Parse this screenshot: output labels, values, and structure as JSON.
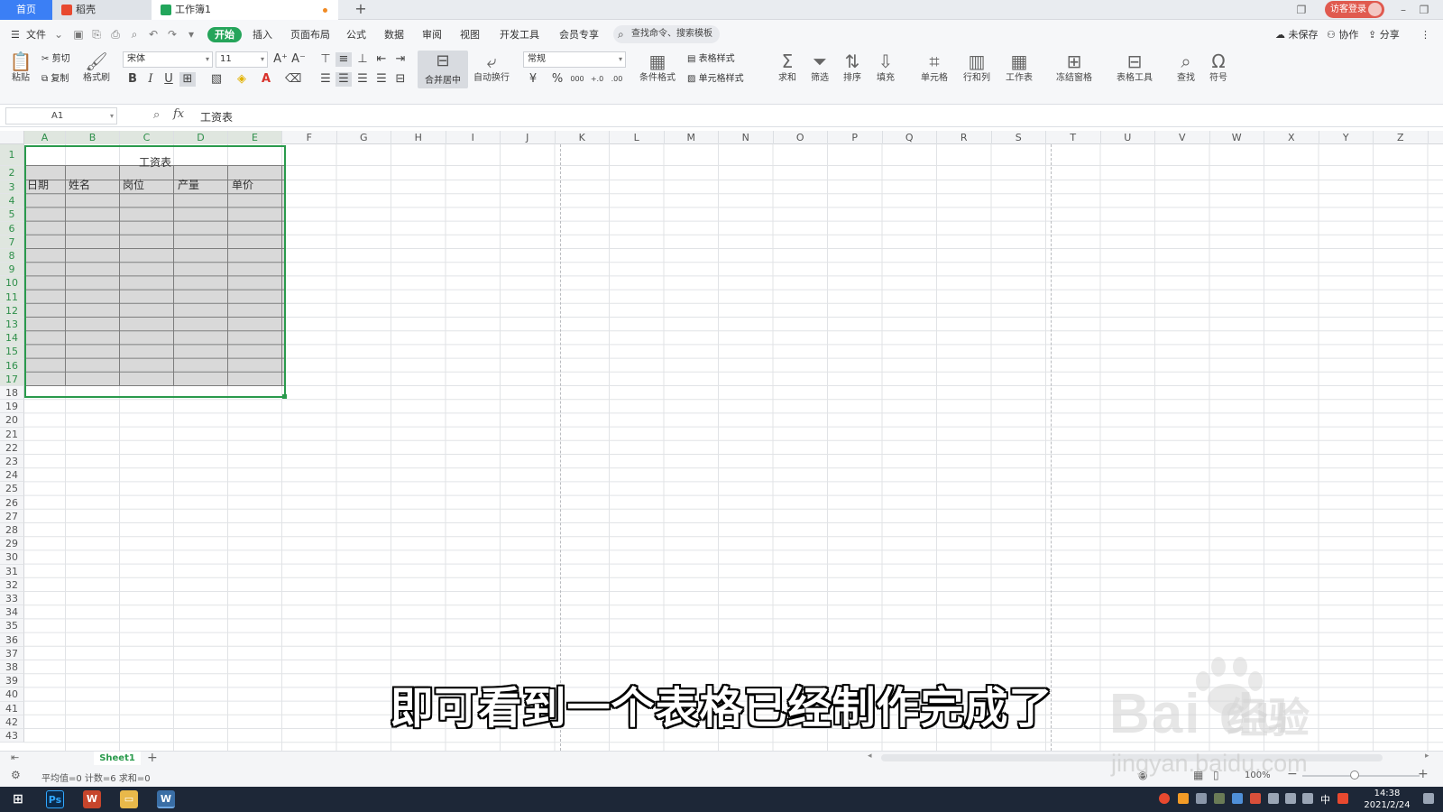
{
  "tabs": {
    "home": "首页",
    "wps": "稻壳",
    "workbook": "工作簿1",
    "add": "+"
  },
  "titlebar": {
    "visitor_login": "访客登录"
  },
  "menu": {
    "file": "文件",
    "items": [
      "开始",
      "插入",
      "页面布局",
      "公式",
      "数据",
      "审阅",
      "视图",
      "开发工具",
      "会员专享"
    ],
    "search_placeholder": "查找命令、搜索模板",
    "unsaved": "未保存",
    "collab": "协作",
    "share": "分享"
  },
  "ribbon": {
    "paste": "粘贴",
    "cut": "剪切",
    "copy": "复制",
    "format_painter": "格式刷",
    "font": "宋体",
    "size": "11",
    "bold": "B",
    "italic": "I",
    "underline": "U",
    "merge_center": "合并居中",
    "wrap": "自动换行",
    "number_format": "常规",
    "currency": "¥",
    "percent": "%",
    "thousands": "000",
    "inc_decimal": "+.0",
    "dec_decimal": ".00",
    "cond_format": "条件格式",
    "table_style": "表格样式",
    "cell_style": "单元格样式",
    "sum": "求和",
    "filter": "筛选",
    "sort": "排序",
    "fill": "填充",
    "cell": "单元格",
    "rowcol": "行和列",
    "worksheet": "工作表",
    "freeze": "冻结窗格",
    "table_tools": "表格工具",
    "find": "查找",
    "symbol": "符号"
  },
  "formula_bar": {
    "name_box": "A1",
    "fx": "fx",
    "content": "工资表"
  },
  "sheet": {
    "columns": [
      "A",
      "B",
      "C",
      "D",
      "E",
      "F",
      "G",
      "H",
      "I",
      "J",
      "K",
      "L",
      "M",
      "N",
      "O",
      "P",
      "Q",
      "R",
      "S",
      "T",
      "U",
      "V",
      "W",
      "X",
      "Y",
      "Z"
    ],
    "row_count": 43,
    "title": "工资表",
    "headers": [
      "日期",
      "姓名",
      "岗位",
      "产量",
      "单价"
    ]
  },
  "sheet_tabs": {
    "active": "Sheet1",
    "add": "+"
  },
  "status": {
    "summary": "平均值=0  计数=6  求和=0",
    "zoom": "100%"
  },
  "taskbar": {
    "time": "14:38",
    "date": "2021/2/24",
    "ime": "中"
  },
  "overlay": {
    "subtitle": "即可看到一个表格已经制作完成了",
    "watermark_url": "jingyan.baidu.com"
  }
}
